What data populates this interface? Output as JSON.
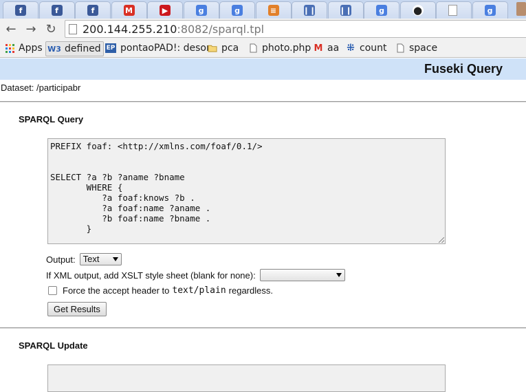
{
  "browser": {
    "tabs": [
      {
        "icon": "facebook-icon",
        "glyph": "f",
        "color": "#3b5998"
      },
      {
        "icon": "facebook-icon",
        "glyph": "f",
        "color": "#3b5998"
      },
      {
        "icon": "facebook-icon",
        "glyph": "f",
        "color": "#3b5998"
      },
      {
        "icon": "gmail-icon",
        "glyph": "M",
        "color": "#d93025"
      },
      {
        "icon": "youtube-icon",
        "glyph": "▶",
        "color": "#cc181e"
      },
      {
        "icon": "google-icon",
        "glyph": "g",
        "color": "#4a7fe0"
      },
      {
        "icon": "google-icon",
        "glyph": "g",
        "color": "#4a7fe0"
      },
      {
        "icon": "stack-overflow-icon",
        "glyph": "≡",
        "color": "#e2802a"
      },
      {
        "icon": "slides-icon",
        "glyph": "❙❙",
        "color": "#4a6fb5"
      },
      {
        "icon": "slides-icon",
        "glyph": "❙❙",
        "color": "#4a6fb5"
      },
      {
        "icon": "google-icon",
        "glyph": "g",
        "color": "#4a7fe0"
      },
      {
        "icon": "github-icon",
        "glyph": "●",
        "color": "#222222"
      },
      {
        "icon": "page-icon",
        "glyph": "",
        "color": "#ffffff"
      },
      {
        "icon": "google-icon",
        "glyph": "g",
        "color": "#4a7fe0"
      }
    ],
    "url_host": "200.144.255.210",
    "url_rest": ":8082/sparql.tpl",
    "bookmarks": {
      "apps": "Apps",
      "defined": "defined",
      "pontao": "pontaoPAD!: desor",
      "pca": "pca",
      "photo": "photo.php",
      "aa": "aa",
      "count": "count",
      "space": "space"
    }
  },
  "page": {
    "title": "Fuseki Query",
    "dataset": "Dataset: /participabr",
    "query_section_title": "SPARQL Query",
    "query_text": "PREFIX foaf: <http://xmlns.com/foaf/0.1/>\n\n\nSELECT ?a ?b ?aname ?bname\n       WHERE {\n          ?a foaf:knows ?b .\n          ?a foaf:name ?aname .\n          ?b foaf:name ?bname .\n       }",
    "output_label": "Output:",
    "output_value": "Text",
    "xslt_label": "If XML output, add XSLT style sheet (blank for none):",
    "xslt_value": "",
    "force_label_pre": "Force the accept header to",
    "force_label_code": "text/plain",
    "force_label_post": "regardless.",
    "get_results": "Get Results",
    "update_section_title": "SPARQL Update",
    "update_text": ""
  },
  "colors": {
    "header_bg": "#cfe2f8",
    "tabstrip_bg": "#c7d7ef"
  }
}
